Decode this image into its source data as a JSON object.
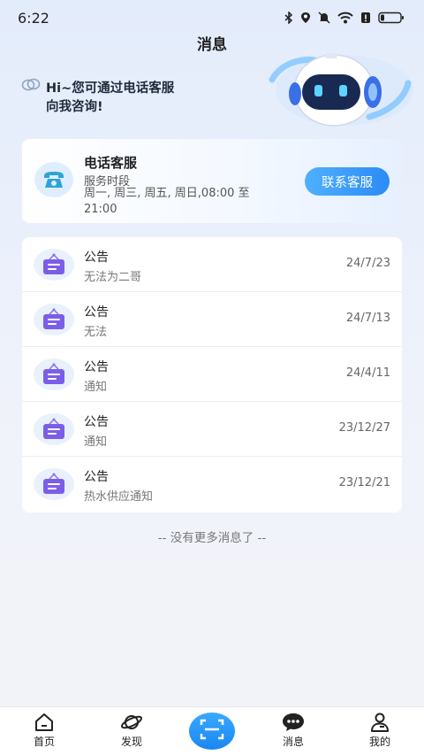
{
  "status_bar": {
    "time": "6:22",
    "icons": [
      "bluetooth-icon",
      "location-icon",
      "mute-icon",
      "wifi-icon",
      "alert-icon",
      "battery-icon"
    ]
  },
  "header": {
    "title": "消息"
  },
  "hero": {
    "greeting_line1": "Hi~您可通过电话客服",
    "greeting_line2": "向我咨询!",
    "icon": "robot-mascot"
  },
  "service": {
    "title": "电话客服",
    "subtitle": "服务时段",
    "hours": "周一, 周三, 周五, 周日,08:00 至 21:00",
    "button_label": "联系客服",
    "icon": "telephone-icon",
    "accent_color": "#2c8bf5"
  },
  "notices": [
    {
      "title": "公告",
      "content": "无法为二哥",
      "date": "24/7/23"
    },
    {
      "title": "公告",
      "content": "无法",
      "date": "24/7/13"
    },
    {
      "title": "公告",
      "content": "通知",
      "date": "24/4/11"
    },
    {
      "title": "公告",
      "content": "通知",
      "date": "23/12/27"
    },
    {
      "title": "公告",
      "content": "热水供应通知",
      "date": "23/12/21"
    }
  ],
  "footer_text": "-- 没有更多消息了 --",
  "bottom_nav": {
    "items": [
      {
        "label": "首页",
        "icon": "home-icon"
      },
      {
        "label": "发现",
        "icon": "planet-icon"
      },
      {
        "label": "",
        "icon": "scan-icon"
      },
      {
        "label": "消息",
        "icon": "message-icon"
      },
      {
        "label": "我的",
        "icon": "profile-icon"
      }
    ]
  }
}
